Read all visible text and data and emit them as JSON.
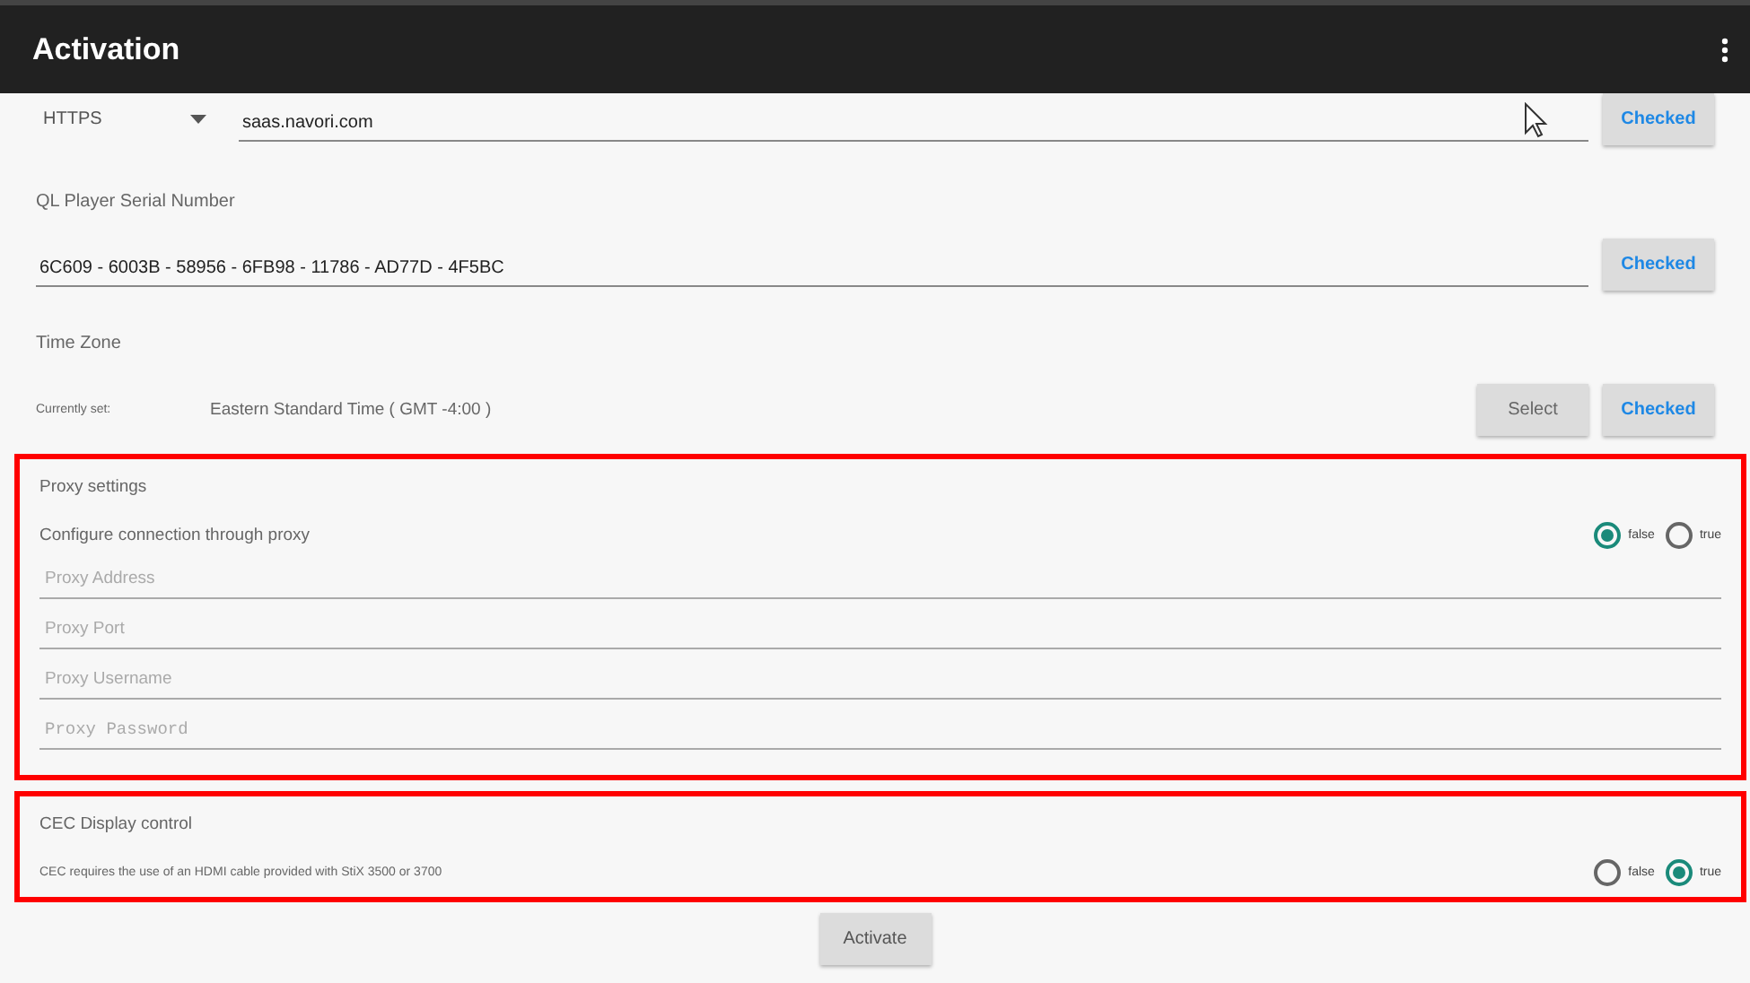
{
  "app_bar": {
    "title": "Activation"
  },
  "server": {
    "protocol": "HTTPS",
    "address": "saas.navori.com",
    "button": "Checked"
  },
  "serial": {
    "label": "QL Player Serial Number",
    "value": "6C609 - 6003B - 58956 - 6FB98 - 11786 - AD77D - 4F5BC",
    "button": "Checked"
  },
  "time_zone": {
    "label": "Time Zone",
    "current_label": "Currently set:",
    "current_value": "Eastern Standard Time ( GMT -4:00 )",
    "buttons": [
      "Select",
      "Checked"
    ]
  },
  "proxy": {
    "title": "Proxy settings",
    "option_label": "Configure connection through proxy",
    "options": [
      {
        "label": "false",
        "selected": true
      },
      {
        "label": "true",
        "selected": false
      }
    ],
    "fields": [
      {
        "placeholder": "Proxy Address",
        "kind": "text"
      },
      {
        "placeholder": "Proxy Port",
        "kind": "text"
      },
      {
        "placeholder": "Proxy Username",
        "kind": "text"
      },
      {
        "placeholder": "Proxy Password",
        "kind": "password"
      }
    ]
  },
  "cec": {
    "title": "CEC Display control",
    "note": "CEC requires the use of an HDMI cable provided with StiX 3500 or 3700",
    "options": [
      {
        "label": "false",
        "selected": false
      },
      {
        "label": "true",
        "selected": true
      }
    ]
  },
  "activate_button": "Activate"
}
